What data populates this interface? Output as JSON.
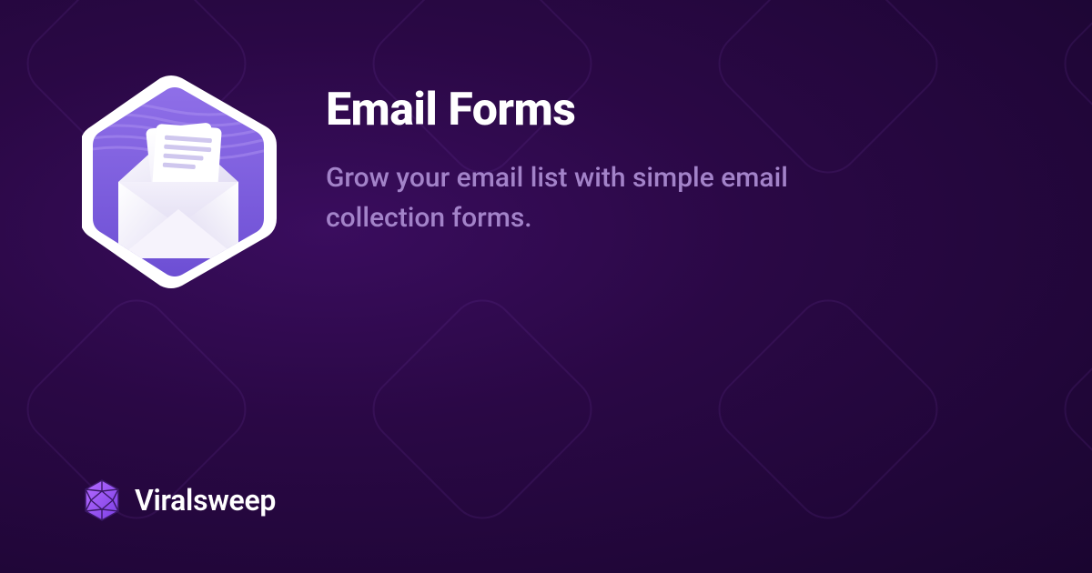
{
  "hero": {
    "title": "Email Forms",
    "subtitle": "Grow your email list with simple email collection forms."
  },
  "brand": {
    "name": "Viralsweep"
  }
}
